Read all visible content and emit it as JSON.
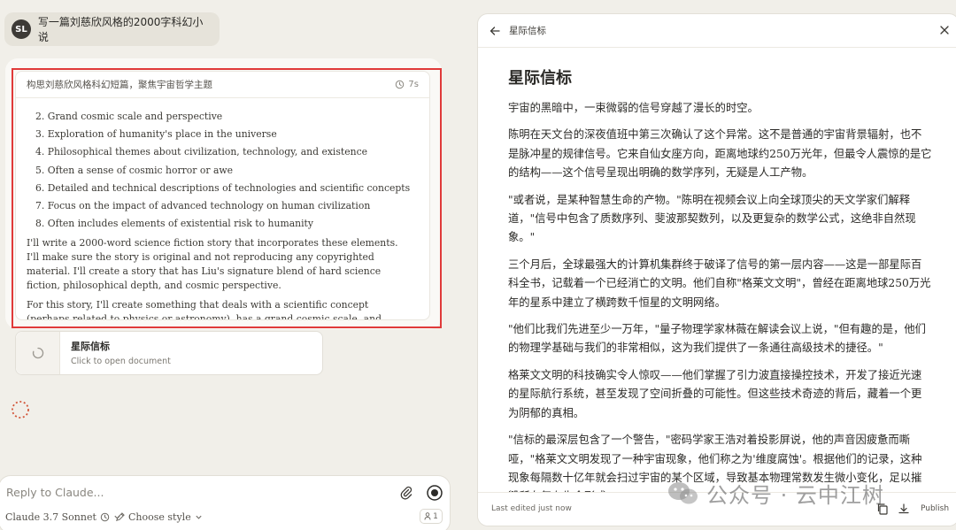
{
  "user_message": {
    "avatar": "SL",
    "text": "写一篇刘慈欣风格的2000字科幻小说"
  },
  "thinking": {
    "title": "构思刘慈欣风格科幻短篇，聚焦宇宙哲学主题",
    "time": "7s",
    "list_items": [
      "2. Grand cosmic scale and perspective",
      "3. Exploration of humanity's place in the universe",
      "4. Philosophical themes about civilization, technology, and existence",
      "5. Often a sense of cosmic horror or awe",
      "6. Detailed and technical descriptions of technologies and scientific concepts",
      "7. Focus on the impact of advanced technology on human civilization",
      "8. Often includes elements of existential risk to humanity"
    ],
    "paragraphs": [
      "I'll write a 2000-word science fiction story that incorporates these elements. I'll make sure the story is original and not reproducing any copyrighted material. I'll create a story that has Liu's signature blend of hard science fiction, philosophical depth, and cosmic perspective.",
      "For this story, I'll create something that deals with a scientific concept (perhaps related to physics or astronomy), has a grand cosmic scale, and explores some philosophical"
    ]
  },
  "document_card": {
    "title": "星际信标",
    "subtitle": "Click to open document"
  },
  "composer": {
    "placeholder": "Reply to Claude...",
    "model": "Claude 3.7 Sonnet",
    "style": "Choose style",
    "counter": "1"
  },
  "artifact": {
    "header_title": "星际信标",
    "title": "星际信标",
    "paragraphs": [
      "宇宙的黑暗中，一束微弱的信号穿越了漫长的时空。",
      "陈明在天文台的深夜值班中第三次确认了这个异常。这不是普通的宇宙背景辐射，也不是脉冲星的规律信号。它来自仙女座方向，距离地球约250万光年，但最令人震惊的是它的结构——这个信号呈现出明确的数学序列，无疑是人工产物。",
      "\"或者说，是某种智慧生命的产物。\"陈明在视频会议上向全球顶尖的天文学家们解释道，\"信号中包含了质数序列、斐波那契数列，以及更复杂的数学公式，这绝非自然现象。\"",
      "三个月后，全球最强大的计算机集群终于破译了信号的第一层内容——这是一部星际百科全书，记载着一个已经消亡的文明。他们自称\"格莱文文明\"，曾经在距离地球250万光年的星系中建立了横跨数千恒星的文明网络。",
      "\"他们比我们先进至少一万年，\"量子物理学家林薇在解读会议上说，\"但有趣的是，他们的物理学基础与我们的非常相似，这为我们提供了一条通往高级技术的捷径。\"",
      "格莱文文明的科技确实令人惊叹——他们掌握了引力波直接操控技术，开发了接近光速的星际航行系统，甚至发现了空间折叠的可能性。但这些技术奇迹的背后，藏着一个更为阴郁的真相。",
      "\"信标的最深层包含了一个警告，\"密码学家王浩对着投影屏说，他的声音因疲惫而嘶哑，\"格莱文文明发现了一种宇宙现象，他们称之为'维度腐蚀'。根据他们的记录，这种现象每隔数十亿年就会扫过宇宙的某个区域，导致基本物理常数发生微小变化，足以摧毁所有复杂生命形式。\""
    ],
    "last_edited": "Last edited just now",
    "publish": "Publish"
  },
  "watermark": {
    "text": "公众号 · 云中江树"
  }
}
